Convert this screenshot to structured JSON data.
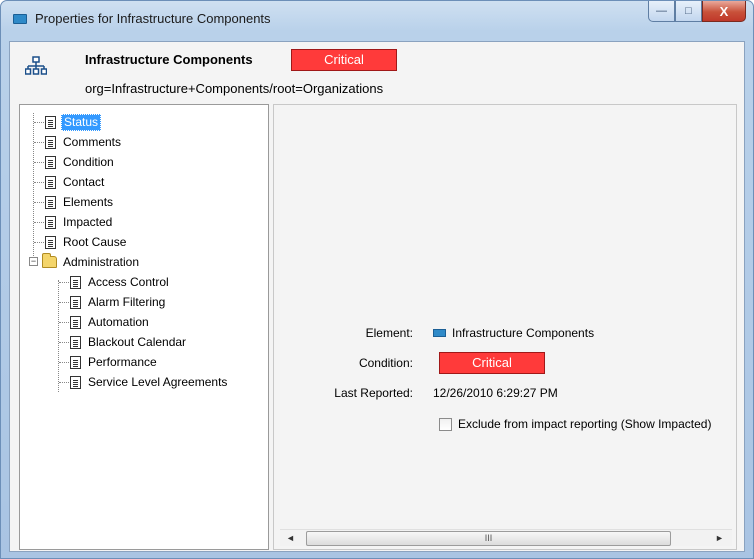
{
  "window": {
    "title": "Properties for Infrastructure Components",
    "min_label": "—",
    "max_label": "□",
    "close_label": "X"
  },
  "header": {
    "org_name": "Infrastructure Components",
    "status": "Critical",
    "org_path": "org=Infrastructure+Components/root=Organizations",
    "icon": "org-chart-icon"
  },
  "tree": {
    "items": [
      {
        "label": "Status",
        "icon": "document-icon"
      },
      {
        "label": "Comments",
        "icon": "document-icon"
      },
      {
        "label": "Condition",
        "icon": "document-icon"
      },
      {
        "label": "Contact",
        "icon": "document-icon"
      },
      {
        "label": "Elements",
        "icon": "document-icon"
      },
      {
        "label": "Impacted",
        "icon": "document-icon"
      },
      {
        "label": "Root Cause",
        "icon": "document-icon"
      },
      {
        "label": "Administration",
        "icon": "folder-icon"
      },
      {
        "label": "Access Control",
        "icon": "document-icon"
      },
      {
        "label": "Alarm Filtering",
        "icon": "document-icon"
      },
      {
        "label": "Automation",
        "icon": "document-icon"
      },
      {
        "label": "Blackout Calendar",
        "icon": "document-icon"
      },
      {
        "label": "Performance",
        "icon": "document-icon"
      },
      {
        "label": "Service Level Agreements",
        "icon": "document-icon"
      }
    ],
    "expander": "−"
  },
  "detail": {
    "element_label": "Element:",
    "element_value": "Infrastructure Components",
    "condition_label": "Condition:",
    "condition_value": "Critical",
    "reported_label": "Last Reported:",
    "reported_value": "12/26/2010 6:29:27 PM",
    "exclude_label": "Exclude from impact reporting (Show Impacted)",
    "exclude_checked": false
  },
  "scrollbar": {
    "left_arrow": "◄",
    "right_arrow": "►",
    "thumb_grip": "III"
  },
  "colors": {
    "critical": "#ff3a3a",
    "selection": "#3399ff"
  }
}
